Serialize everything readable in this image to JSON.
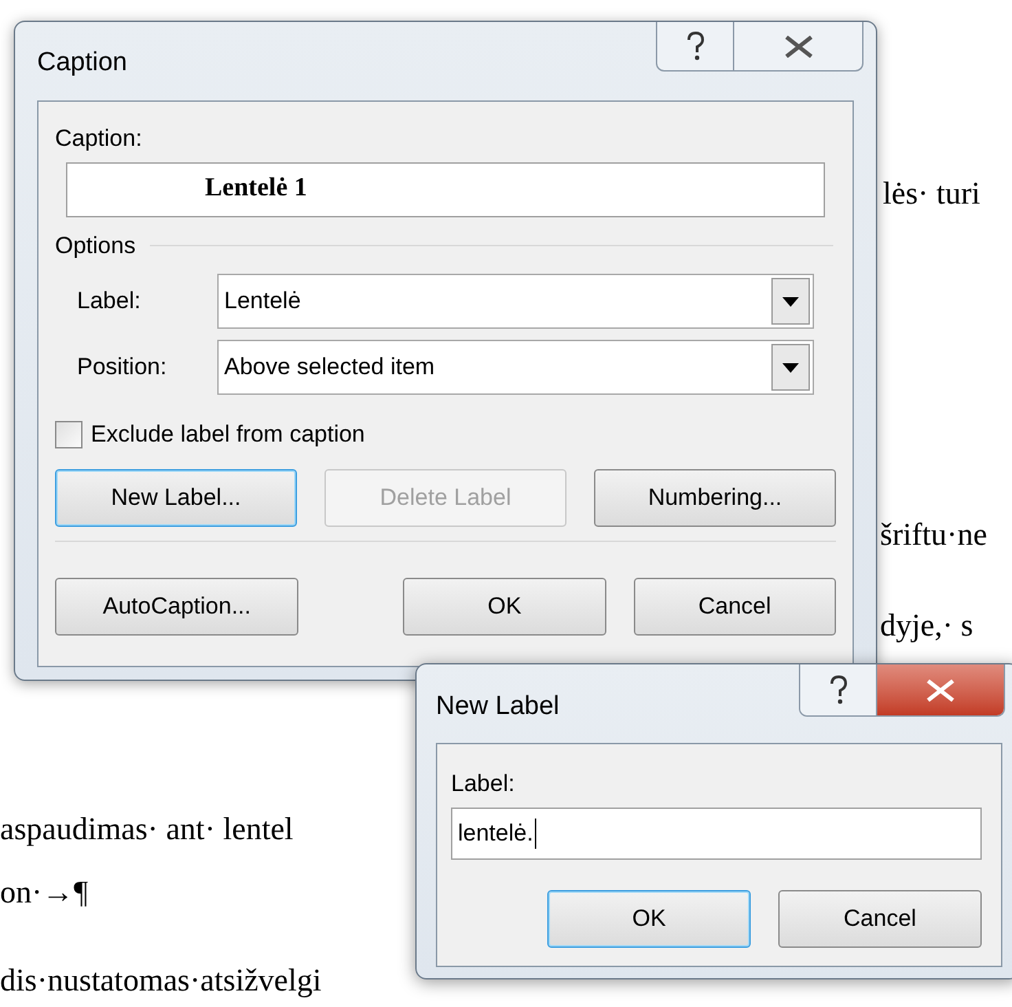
{
  "document": {
    "lines": [
      {
        "text": "lės· turi"
      },
      {
        "text": "šriftu·ne"
      },
      {
        "text": "dyje,· s"
      },
      {
        "text": "aspaudimas· ant· lentel"
      },
      {
        "text": "on·→¶"
      },
      {
        "text": "dis·nustatomas·atsižvelgi"
      }
    ]
  },
  "caption_dialog": {
    "title": "Caption",
    "caption_field": {
      "label": "Caption:",
      "value": "Lentelė 1"
    },
    "options_heading": "Options",
    "label_combo": {
      "label": "Label:",
      "value": "Lentelė"
    },
    "position_combo": {
      "label": "Position:",
      "value": "Above selected item"
    },
    "exclude_checkbox": {
      "label": "Exclude label from caption",
      "checked": false
    },
    "label_buttons": [
      {
        "label": "New Label...",
        "focused": true,
        "disabled": false
      },
      {
        "label": "Delete Label",
        "focused": false,
        "disabled": true
      },
      {
        "label": "Numbering...",
        "focused": false,
        "disabled": false
      }
    ],
    "bottom_buttons": [
      {
        "label": "AutoCaption...",
        "focused": false,
        "disabled": false
      },
      {
        "label": "OK",
        "focused": false,
        "disabled": false
      },
      {
        "label": "Cancel",
        "focused": false,
        "disabled": false
      }
    ]
  },
  "new_label_dialog": {
    "title": "New Label",
    "label_field": {
      "label": "Label:",
      "value": "lentelė."
    },
    "buttons": [
      {
        "label": "OK",
        "focused": true,
        "disabled": false
      },
      {
        "label": "Cancel",
        "focused": false,
        "disabled": false
      }
    ]
  }
}
